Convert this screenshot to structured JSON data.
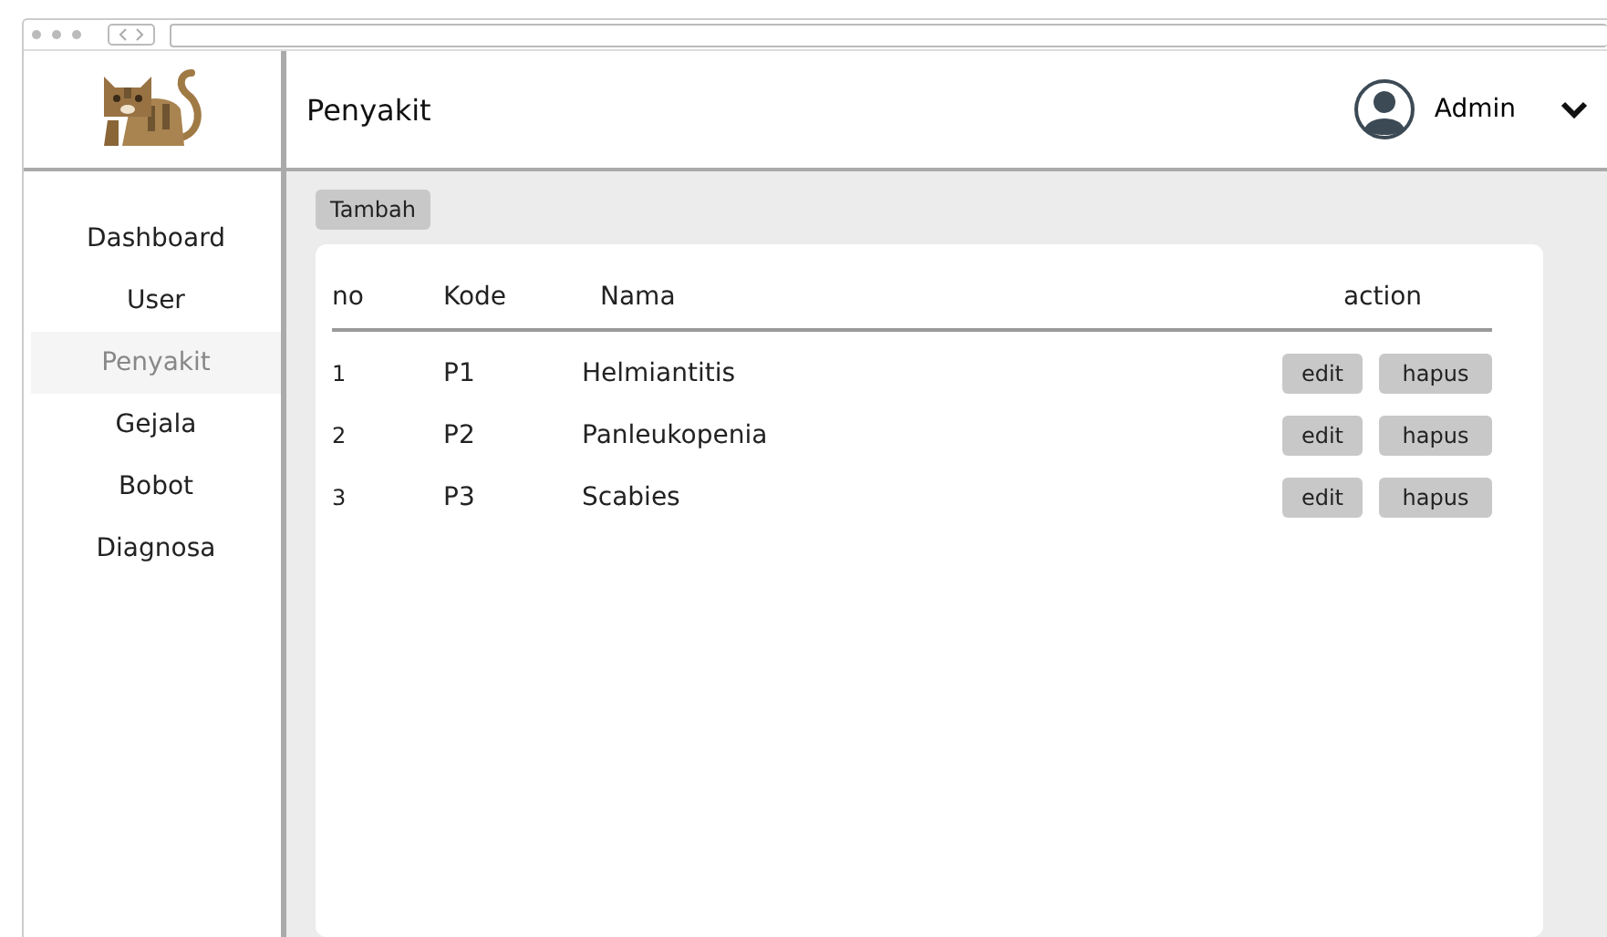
{
  "header": {
    "title": "Penyakit",
    "user": "Admin"
  },
  "sidebar": {
    "items": [
      {
        "label": "Dashboard",
        "selected": false
      },
      {
        "label": "User",
        "selected": false
      },
      {
        "label": "Penyakit",
        "selected": true
      },
      {
        "label": "Gejala",
        "selected": false
      },
      {
        "label": "Bobot",
        "selected": false
      },
      {
        "label": "Diagnosa",
        "selected": false
      }
    ]
  },
  "add_button": "Tambah",
  "table": {
    "columns": [
      "no",
      "Kode",
      "Nama",
      "action"
    ],
    "rows": [
      {
        "no": "1",
        "kode": "P1",
        "nama": "Helmiantitis",
        "actions": [
          "edit",
          "hapus"
        ]
      },
      {
        "no": "2",
        "kode": "P2",
        "nama": "Panleukopenia",
        "actions": [
          "edit",
          "hapus"
        ]
      },
      {
        "no": "3",
        "kode": "P3",
        "nama": "Scabies",
        "actions": [
          "edit",
          "hapus"
        ]
      }
    ]
  }
}
